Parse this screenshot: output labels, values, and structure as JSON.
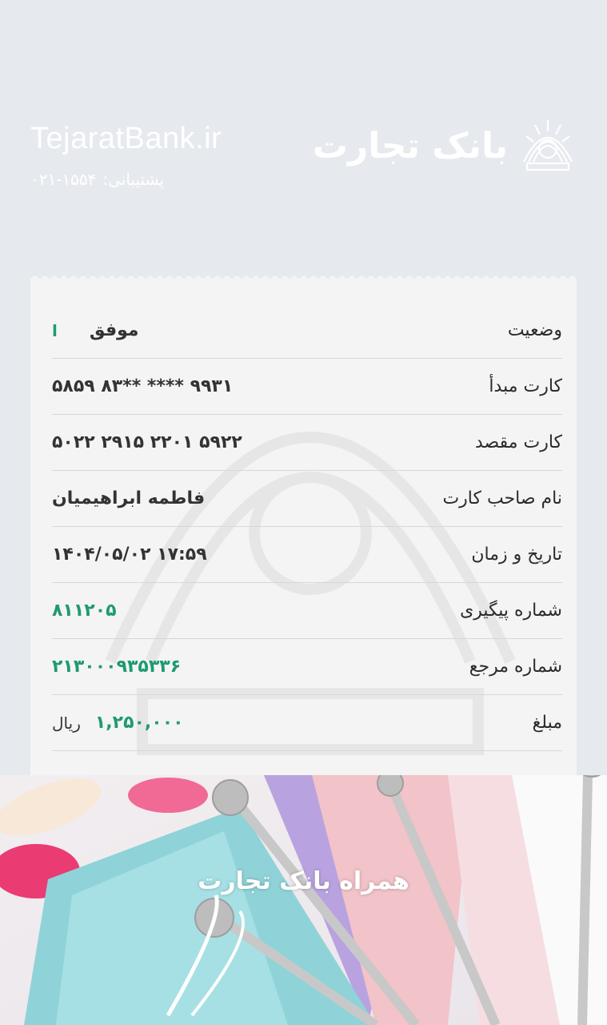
{
  "header": {
    "site": "TejaratBank.ir",
    "support_label": "پشتیبانی:",
    "support_phone": "۰۲۱-۱۵۵۴",
    "logo_text": "بانک تجارت"
  },
  "receipt": {
    "status": {
      "label": "وضعیت",
      "value": "موفق",
      "mark": "ا"
    },
    "source_card": {
      "label": "کارت مبدأ",
      "value": "۵۸۵۹ ۸۳** **** ۹۹۳۱"
    },
    "dest_card": {
      "label": "کارت مقصد",
      "value": "۵۰۲۲ ۲۹۱۵ ۲۲۰۱ ۵۹۲۲"
    },
    "holder": {
      "label": "نام صاحب کارت",
      "value": "فاطمه ابراهیمیان"
    },
    "datetime": {
      "label": "تاریخ و زمان",
      "value": "۱۴۰۴/۰۵/۰۲ ۱۷:۵۹"
    },
    "tracking": {
      "label": "شماره پیگیری",
      "value": "۸۱۱۲۰۵"
    },
    "reference": {
      "label": "شماره مرجع",
      "value": "۲۱۳۰۰۰۹۳۵۳۳۶"
    },
    "amount": {
      "label": "مبلغ",
      "value": "۱,۲۵۰,۰۰۰",
      "unit": "ریال"
    }
  },
  "banner": {
    "text": "همراه بانک تجارت"
  },
  "colors": {
    "accent": "#1e9a72",
    "background": "#e6e9ee",
    "receipt": "#f4f4f4"
  }
}
